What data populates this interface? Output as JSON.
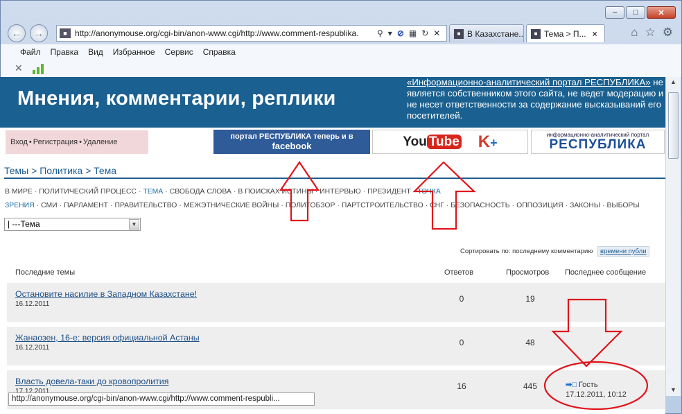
{
  "browser": {
    "address_url": "http://anonymouse.org/cgi-bin/anon-www.cgi/http://www.comment-respublika.",
    "tabs": [
      {
        "label": "В Казахстане..."
      },
      {
        "label": "Тема > П..."
      }
    ],
    "menu": [
      "Файл",
      "Правка",
      "Вид",
      "Избранное",
      "Сервис",
      "Справка"
    ],
    "status_url": "http://anonymouse.org/cgi-bin/anon-www.cgi/http://www.comment-respubli..."
  },
  "site": {
    "title": "Мнения, комментарии, реплики",
    "disclaimer_link": "«Информационно-аналитический портал РЕСПУБЛИКА»",
    "disclaimer_text": "не является собственником этого сайта, не ведет модерацию и не несет ответственности за содержание высказываний его посетителей.",
    "login": {
      "enter": "Вход",
      "register": "Регистрация",
      "delete": "Удаление"
    },
    "ads": {
      "facebook_line1": "портал РЕСПУБЛИКА теперь и в",
      "facebook_line2": "facebook",
      "youtube_you": "You",
      "youtube_tube": "Tube",
      "kplus_k": "K",
      "kplus_plus": "+",
      "respublika_small": "информационно-аналитический портал",
      "respublika_big": "РЕСПУБЛИКА"
    }
  },
  "breadcrumb": "Темы > Политика > Тема",
  "categories": [
    {
      "label": "В МИРЕ",
      "active": false
    },
    {
      "label": "ПОЛИТИЧЕСКИЙ ПРОЦЕСС",
      "active": false
    },
    {
      "label": "ТЕМА",
      "active": true
    },
    {
      "label": "СВОБОДА СЛОВА",
      "active": false
    },
    {
      "label": "В ПОИСКАХ ИСТИНЫ",
      "active": false
    },
    {
      "label": "ИНТЕРВЬЮ",
      "active": false
    },
    {
      "label": "ПРЕЗИДЕНТ",
      "active": false
    },
    {
      "label": "ТОЧКА ЗРЕНИЯ",
      "active": true
    },
    {
      "label": "СМИ",
      "active": false
    },
    {
      "label": "ПАРЛАМЕНТ",
      "active": false
    },
    {
      "label": "ПРАВИТЕЛЬСТВО",
      "active": false
    },
    {
      "label": "МЕЖЭТНИЧЕСКИЕ ВОЙНЫ",
      "active": false
    },
    {
      "label": "ПОЛИТОБЗОР",
      "active": false
    },
    {
      "label": "ПАРТСТРОИТЕЛЬСТВО",
      "active": false
    },
    {
      "label": "СНГ",
      "active": false
    },
    {
      "label": "БЕЗОПАСНОСТЬ",
      "active": false
    },
    {
      "label": "ОППОЗИЦИЯ",
      "active": false
    },
    {
      "label": "ЗАКОНЫ",
      "active": false
    },
    {
      "label": "ВЫБОРЫ",
      "active": false
    }
  ],
  "topic_select": "| ---Тема",
  "sort": {
    "label": "Сортировать по:",
    "current": "последнему комментарию",
    "alt": "времени публи"
  },
  "table": {
    "headers": {
      "topic": "Последние темы",
      "replies": "Ответов",
      "views": "Просмотров",
      "last": "Последнее сообщение"
    },
    "rows": [
      {
        "title": "Остановите насилие в Западном Казахстане!",
        "date": "16.12.2011",
        "replies": "0",
        "views": "19",
        "last_author": "",
        "last_date": ""
      },
      {
        "title": "Жанаозен, 16-е: версия официальной Астаны",
        "date": "16.12.2011",
        "replies": "0",
        "views": "48",
        "last_author": "",
        "last_date": ""
      },
      {
        "title": "Власть довела-таки до кровопролития",
        "date": "17.12.2011",
        "replies": "16",
        "views": "445",
        "last_author": "Гость",
        "last_date": "17.12.2011, 10:12"
      }
    ]
  },
  "annotation_color": "#e0141b"
}
